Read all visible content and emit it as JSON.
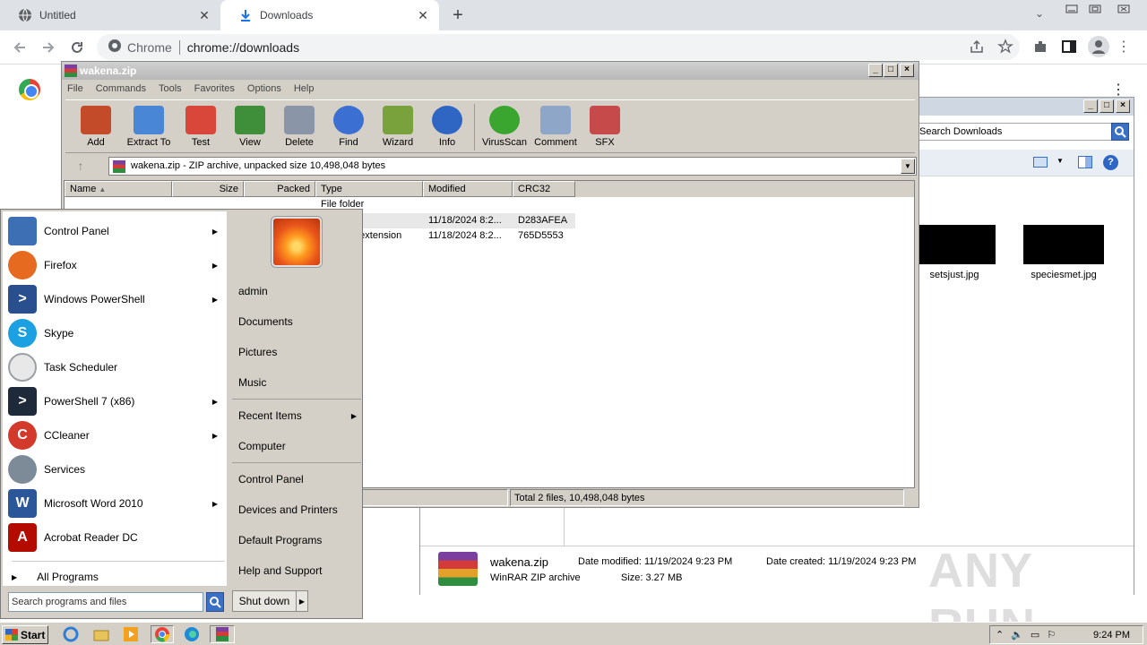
{
  "chrome": {
    "tabs": [
      {
        "label": "Untitled",
        "icon": "globe-icon"
      },
      {
        "label": "Downloads",
        "icon": "download-icon"
      }
    ],
    "omnibox_site": "Chrome",
    "url": "chrome://downloads"
  },
  "explorer": {
    "search_placeholder": "Search Downloads",
    "thumbnails": [
      {
        "label": "setsjust.jpg"
      },
      {
        "label": "speciesmet.jpg"
      }
    ],
    "details": {
      "name": "wakena.zip",
      "type": "WinRAR ZIP archive",
      "date_modified": "Date modified: 11/19/2024 9:23 PM",
      "date_created": "Date created: 11/19/2024 9:23 PM",
      "size": "Size: 3.27 MB"
    }
  },
  "winrar": {
    "title": "wakena.zip",
    "menu": [
      "File",
      "Commands",
      "Tools",
      "Favorites",
      "Options",
      "Help"
    ],
    "tools": [
      {
        "label": "Add",
        "color": "#c44b2a"
      },
      {
        "label": "Extract To",
        "color": "#4a86d6"
      },
      {
        "label": "Test",
        "color": "#d8473a"
      },
      {
        "label": "View",
        "color": "#3f8f3a"
      },
      {
        "label": "Delete",
        "color": "#8a96a8"
      },
      {
        "label": "Find",
        "color": "#3b6fd1"
      },
      {
        "label": "Wizard",
        "color": "#7aa23c"
      },
      {
        "label": "Info",
        "color": "#2f66c4"
      },
      {
        "label": "VirusScan",
        "color": "#3aa52f"
      },
      {
        "label": "Comment",
        "color": "#8ea6c8"
      },
      {
        "label": "SFX",
        "color": "#c74a4a"
      }
    ],
    "path": "wakena.zip - ZIP archive, unpacked size 10,498,048 bytes",
    "columns": [
      "Name",
      "Size",
      "Packed",
      "Type",
      "Modified",
      "CRC32"
    ],
    "rows": [
      {
        "name": "..",
        "type": "File folder",
        "modified": "",
        "crc": ""
      },
      {
        "name": "",
        "type": "n",
        "modified": "11/18/2024 8:2...",
        "crc": "D283AFEA"
      },
      {
        "name": "",
        "type": "n extension",
        "modified": "11/18/2024 8:2...",
        "crc": "765D5553"
      }
    ],
    "status": "Total 2 files, 10,498,048 bytes"
  },
  "startmenu": {
    "programs": [
      {
        "label": "Control Panel",
        "icon": "control-panel-icon",
        "arrow": true,
        "color": "#3d6fb5"
      },
      {
        "label": "Firefox",
        "icon": "firefox-icon",
        "arrow": true,
        "color": "#e66a1f"
      },
      {
        "label": "Windows PowerShell",
        "icon": "powershell-icon",
        "arrow": true,
        "color": "#2a4f8f"
      },
      {
        "label": "Skype",
        "icon": "skype-icon",
        "arrow": false,
        "color": "#1ba0e1"
      },
      {
        "label": "Task Scheduler",
        "icon": "task-scheduler-icon",
        "arrow": false,
        "color": "#9aa0a6"
      },
      {
        "label": "PowerShell 7 (x86)",
        "icon": "powershell7-icon",
        "arrow": true,
        "color": "#1e2a3a"
      },
      {
        "label": "CCleaner",
        "icon": "ccleaner-icon",
        "arrow": true,
        "color": "#d33a2c"
      },
      {
        "label": "Services",
        "icon": "services-icon",
        "arrow": false,
        "color": "#7d8b99"
      },
      {
        "label": "Microsoft Word 2010",
        "icon": "word-icon",
        "arrow": true,
        "color": "#2b579a"
      },
      {
        "label": "Acrobat Reader DC",
        "icon": "acrobat-icon",
        "arrow": false,
        "color": "#b30b00"
      }
    ],
    "all_programs": "All Programs",
    "search_placeholder": "Search programs and files",
    "right": {
      "user": "admin",
      "documents": "Documents",
      "pictures": "Pictures",
      "music": "Music",
      "recent": "Recent Items",
      "computer": "Computer",
      "control_panel": "Control Panel",
      "devices": "Devices and Printers",
      "default_programs": "Default Programs",
      "help": "Help and Support"
    },
    "shutdown": "Shut down"
  },
  "taskbar": {
    "start": "Start",
    "clock": "9:24 PM"
  },
  "watermark": "ANY RUN"
}
